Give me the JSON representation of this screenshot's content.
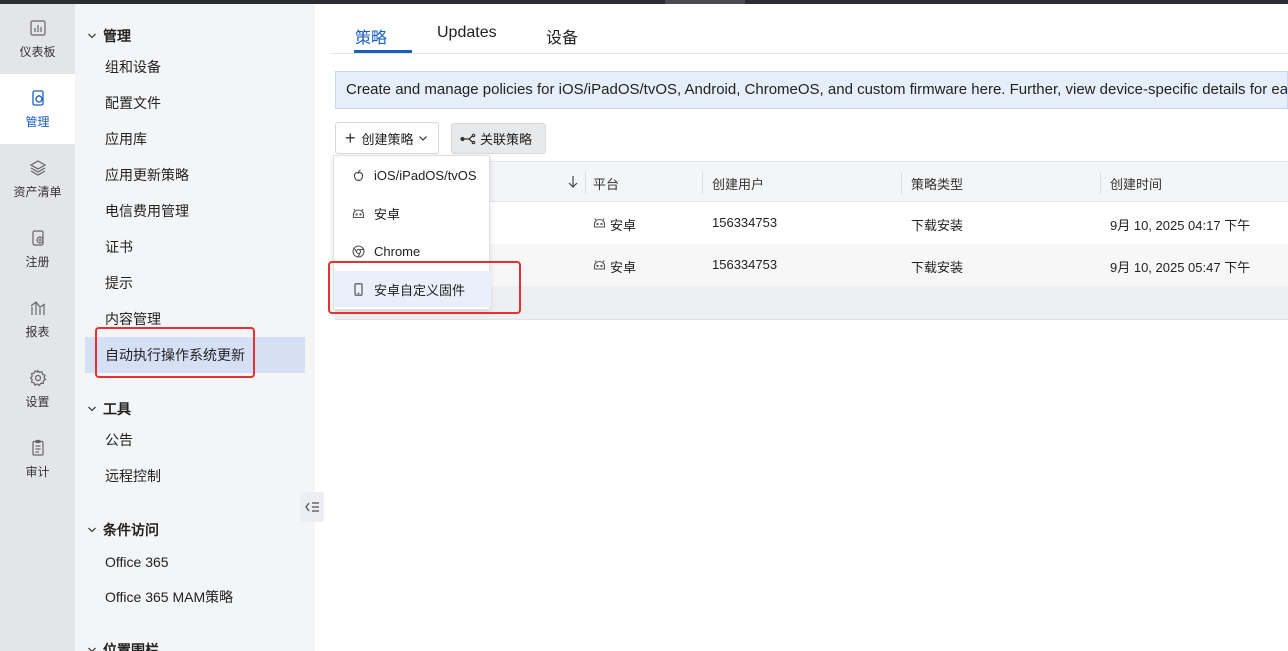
{
  "rail": {
    "items": [
      {
        "label": "仪表板",
        "icon": "dashboard-icon"
      },
      {
        "label": "管理",
        "icon": "manage-icon"
      },
      {
        "label": "资产清单",
        "icon": "inventory-icon"
      },
      {
        "label": "注册",
        "icon": "enroll-icon"
      },
      {
        "label": "报表",
        "icon": "report-icon"
      },
      {
        "label": "设置",
        "icon": "settings-icon"
      },
      {
        "label": "审计",
        "icon": "audit-icon"
      }
    ],
    "active_index": 1
  },
  "subnav": {
    "section_manage": "管理",
    "manage_items": [
      "组和设备",
      "配置文件",
      "应用库",
      "应用更新策略",
      "电信费用管理",
      "证书",
      "提示",
      "内容管理",
      "自动执行操作系统更新"
    ],
    "section_tools": "工具",
    "tools_items": [
      "公告",
      "远程控制"
    ],
    "section_conditional": "条件访问",
    "conditional_items": [
      "Office 365",
      "Office 365 MAM策略"
    ],
    "section_geofence": "位置围栏"
  },
  "tabs": [
    "策略",
    "Updates",
    "设备"
  ],
  "info_text": "Create and manage policies for iOS/iPadOS/tvOS, Android, ChromeOS, and custom firmware here. Further, view device-specific details for each p",
  "toolbar": {
    "create_label": "创建策略",
    "associate_label": "关联策略"
  },
  "table": {
    "headers": [
      "平台",
      "创建用户",
      "策略类型",
      "创建时间"
    ],
    "rows": [
      {
        "platform": "安卓",
        "user": "156334753",
        "type": "下载安装",
        "time": "9月 10, 2025 04:17 下午"
      },
      {
        "platform": "安卓",
        "user": "156334753",
        "type": "下载安装",
        "time": "9月 10, 2025 05:47 下午"
      }
    ]
  },
  "dropdown": {
    "items": [
      "iOS/iPadOS/tvOS",
      "安卓",
      "Chrome",
      "安卓自定义固件"
    ]
  },
  "colors": {
    "accent": "#1a5ec4",
    "highlight": "#e8312f"
  }
}
